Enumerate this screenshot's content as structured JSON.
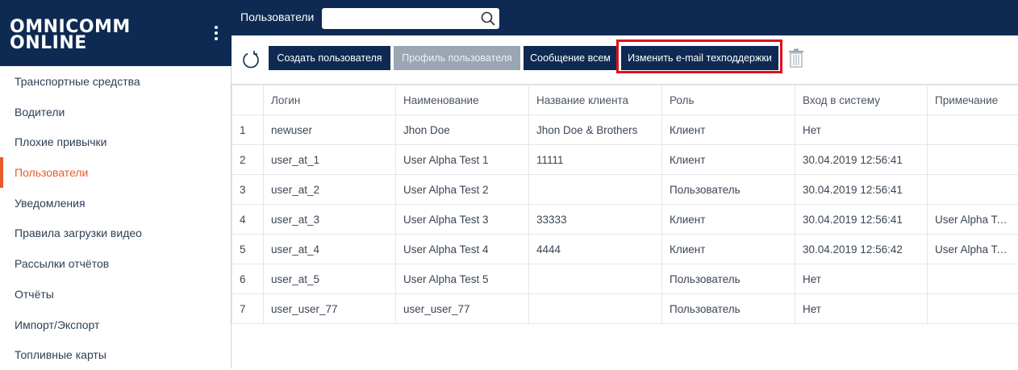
{
  "brand": {
    "line1": "OMNICOMM",
    "line2": "ONLINE"
  },
  "sidebar": {
    "items": [
      {
        "label": "Транспортные средства",
        "active": false
      },
      {
        "label": "Водители",
        "active": false
      },
      {
        "label": "Плохие привычки",
        "active": false
      },
      {
        "label": "Пользователи",
        "active": true
      },
      {
        "label": "Уведомления",
        "active": false
      },
      {
        "label": "Правила загрузки видео",
        "active": false
      },
      {
        "label": "Рассылки отчётов",
        "active": false
      },
      {
        "label": "Отчёты",
        "active": false
      },
      {
        "label": "Импорт/Экспорт",
        "active": false
      },
      {
        "label": "Топливные карты",
        "active": false
      }
    ]
  },
  "topbar": {
    "title": "Пользователи",
    "search_value": "",
    "search_icon": "search-icon"
  },
  "toolbar": {
    "refresh_icon": "refresh-icon",
    "create_user": "Создать пользователя",
    "user_profile": "Профиль пользователя",
    "message_all": "Сообщение всем",
    "change_email": "Изменить e-mail техподдержки",
    "delete_icon": "trash-icon"
  },
  "table": {
    "columns": [
      "",
      "Логин",
      "Наименование",
      "Название клиента",
      "Роль",
      "Вход в систему",
      "Примечание"
    ],
    "rows": [
      [
        "1",
        "newuser",
        "Jhon Doe",
        "Jhon Doe & Brothers",
        "Клиент",
        "Нет",
        ""
      ],
      [
        "2",
        "user_at_1",
        "User Alpha Test 1",
        "11111",
        "Клиент",
        "30.04.2019 12:56:41",
        ""
      ],
      [
        "3",
        "user_at_2",
        "User Alpha Test 2",
        "",
        "Пользователь",
        "30.04.2019 12:56:41",
        ""
      ],
      [
        "4",
        "user_at_3",
        "User Alpha Test 3",
        "33333",
        "Клиент",
        "30.04.2019 12:56:41",
        "User Alpha Te..."
      ],
      [
        "5",
        "user_at_4",
        "User Alpha Test 4",
        "4444",
        "Клиент",
        "30.04.2019 12:56:42",
        "User Alpha Te..."
      ],
      [
        "6",
        "user_at_5",
        "User Alpha Test 5",
        "",
        "Пользователь",
        "Нет",
        ""
      ],
      [
        "7",
        "user_user_77",
        "user_user_77",
        "",
        "Пользователь",
        "Нет",
        ""
      ]
    ]
  },
  "colors": {
    "navy": "#0e2a52",
    "accent": "#e85a28",
    "disabled": "#9aa6b3",
    "highlight": "#e0101a"
  }
}
